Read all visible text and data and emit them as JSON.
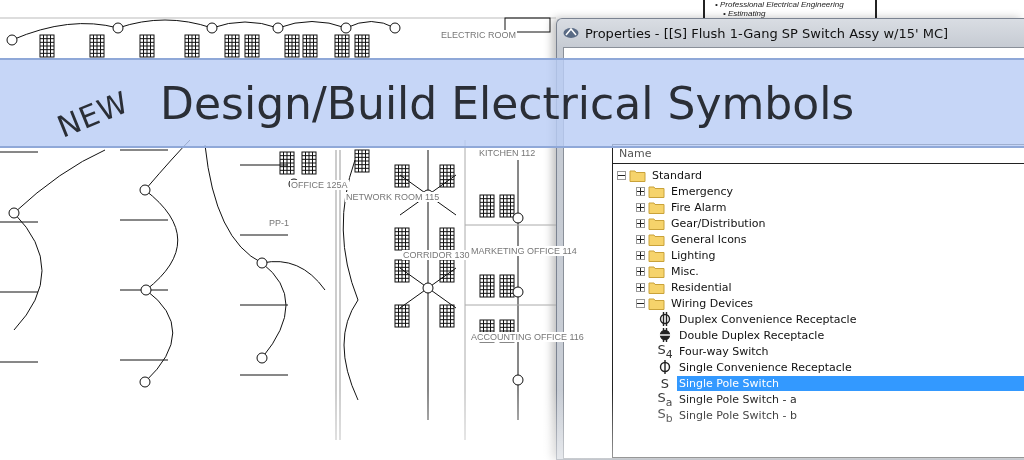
{
  "banner": {
    "badge": "NEW",
    "title": "Design/Build Electrical Symbols"
  },
  "drawing": {
    "labels": [
      "ELECTRIC ROOM",
      "OFFICE 125A",
      "PP-1",
      "NETWORK ROOM 115",
      "KITCHEN 112",
      "CORRIDOR 130",
      "MARKETING OFFICE 114",
      "ACCOUNTING OFFICE 116"
    ]
  },
  "background_document": {
    "bullets": [
      "• Professional Electrical Engineering",
      "• Estimating"
    ]
  },
  "properties": {
    "title": "Properties - [[S] Flush 1-Gang SP Switch Assy w/15' MC]",
    "tree_header": "Name",
    "tree": [
      {
        "label": "Standard",
        "expanded": true,
        "selected": false,
        "children": [
          {
            "label": "Emergency",
            "expanded": false,
            "selected": false
          },
          {
            "label": "Fire Alarm",
            "expanded": false,
            "selected": false
          },
          {
            "label": "Gear/Distribution",
            "expanded": false,
            "selected": false
          },
          {
            "label": "General Icons",
            "expanded": false,
            "selected": false
          },
          {
            "label": "Lighting",
            "expanded": false,
            "selected": false
          },
          {
            "label": "Misc.",
            "expanded": false,
            "selected": false
          },
          {
            "label": "Residential",
            "expanded": false,
            "selected": false
          },
          {
            "label": "Wiring Devices",
            "expanded": true,
            "selected": false,
            "children": [
              {
                "label": "Duplex Convenience Receptacle",
                "kind": "duplex-receptacle",
                "selected": false
              },
              {
                "label": "Double Duplex Receptacle",
                "kind": "double-duplex-receptacle",
                "selected": false
              },
              {
                "label": "Four-way Switch",
                "kind": "switch",
                "symbol": "S$_{4}$",
                "selected": false
              },
              {
                "label": "Single Convenience Receptacle",
                "kind": "single-receptacle",
                "selected": false
              },
              {
                "label": "Single Pole Switch",
                "kind": "switch",
                "symbol": "S",
                "selected": true
              },
              {
                "label": "Single Pole Switch - a",
                "kind": "switch",
                "symbol": "S$_{a}$",
                "selected": false
              },
              {
                "label": "Single Pole Switch - b",
                "kind": "switch",
                "symbol": "S$_{b}$",
                "selected": false
              }
            ]
          }
        ]
      }
    ]
  }
}
